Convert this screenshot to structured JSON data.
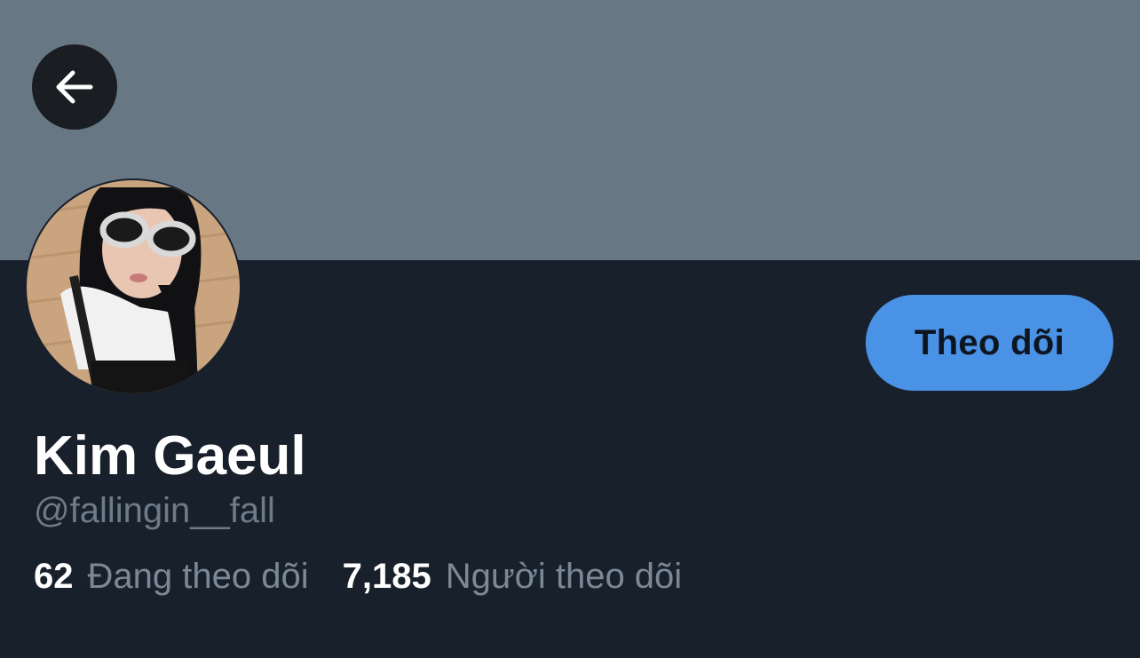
{
  "profile": {
    "display_name": "Kim Gaeul",
    "handle": "@fallingin__fall",
    "follow_label": "Theo dõi"
  },
  "stats": {
    "following_count": "62",
    "following_label": "Đang theo dõi",
    "followers_count": "7,185",
    "followers_label": "Người theo dõi"
  },
  "icons": {
    "back": "arrow-left-icon"
  },
  "colors": {
    "banner": "#687784",
    "background": "#18202b",
    "follow_button": "#4a92e6",
    "secondary_text": "#6e7b88"
  }
}
